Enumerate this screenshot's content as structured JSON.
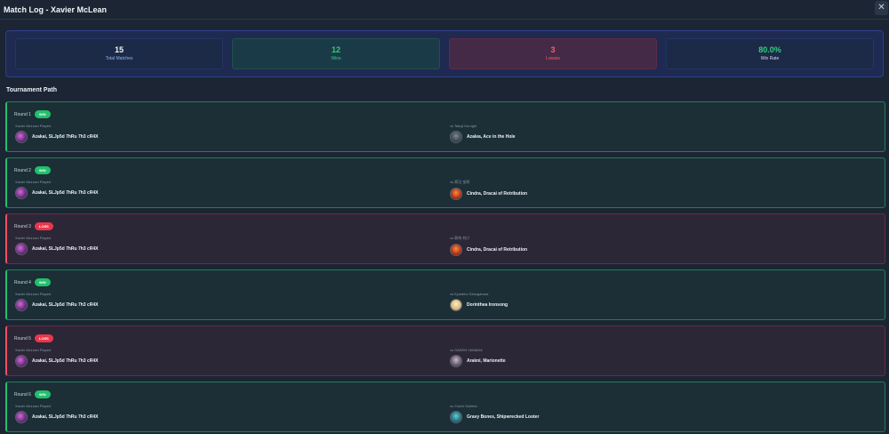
{
  "header": {
    "title": "Match Log - Xavier McLean",
    "close_label": "✕"
  },
  "stats": [
    {
      "value": "15",
      "label": "Total Matches"
    },
    {
      "value": "12",
      "label": "Wins"
    },
    {
      "value": "3",
      "label": "Losses"
    },
    {
      "value": "80.0%",
      "label": "Win Rate"
    }
  ],
  "section_title": "Tournament Path",
  "rounds": [
    {
      "label": "Round 1",
      "result": "WIN",
      "player_label": "Xavier McLean Played",
      "player_deck": "Azakai, SLJp5d 7hRu 7h3 cR4X",
      "opponent_label": "vs Takuji Kurogiri",
      "opponent_deck": "Azalea, Ace in the Hole"
    },
    {
      "label": "Round 2",
      "result": "WIN",
      "player_label": "Xavier McLean Played",
      "player_deck": "Azakai, SLJp5d 7hRu 7h3 cR4X",
      "opponent_label": "vs 郑汉 金明",
      "opponent_deck": "Cindra, Dracai of Retribution"
    },
    {
      "label": "Round 3",
      "result": "LOSS",
      "player_label": "Xavier McLean Played",
      "player_deck": "Azakai, SLJp5d 7hRu 7h3 cR4X",
      "opponent_label": "vs 郭伟 刘け",
      "opponent_deck": "Cindra, Dracai of Retribution"
    },
    {
      "label": "Round 4",
      "result": "WIN",
      "player_label": "Xavier McLean Played",
      "player_deck": "Azakai, SLJp5d 7hRu 7h3 cR4X",
      "opponent_label": "vs Kyoshiro Sekogahara",
      "opponent_deck": "Dorinthea Ironsong"
    },
    {
      "label": "Round 5",
      "result": "LOSS",
      "player_label": "Xavier McLean Played",
      "player_deck": "Azakai, SLJp5d 7hRu 7h3 cR4X",
      "opponent_label": "vs GAKEN YAMADA",
      "opponent_deck": "Arakni, Marionette"
    },
    {
      "label": "Round 6",
      "result": "WIN",
      "player_label": "Xavier McLean Played",
      "player_deck": "Azakai, SLJp5d 7hRu 7h3 cR4X",
      "opponent_label": "vs Yuichi Oshima",
      "opponent_deck": "Gravy Bones, Shipwrecked Looter"
    }
  ]
}
